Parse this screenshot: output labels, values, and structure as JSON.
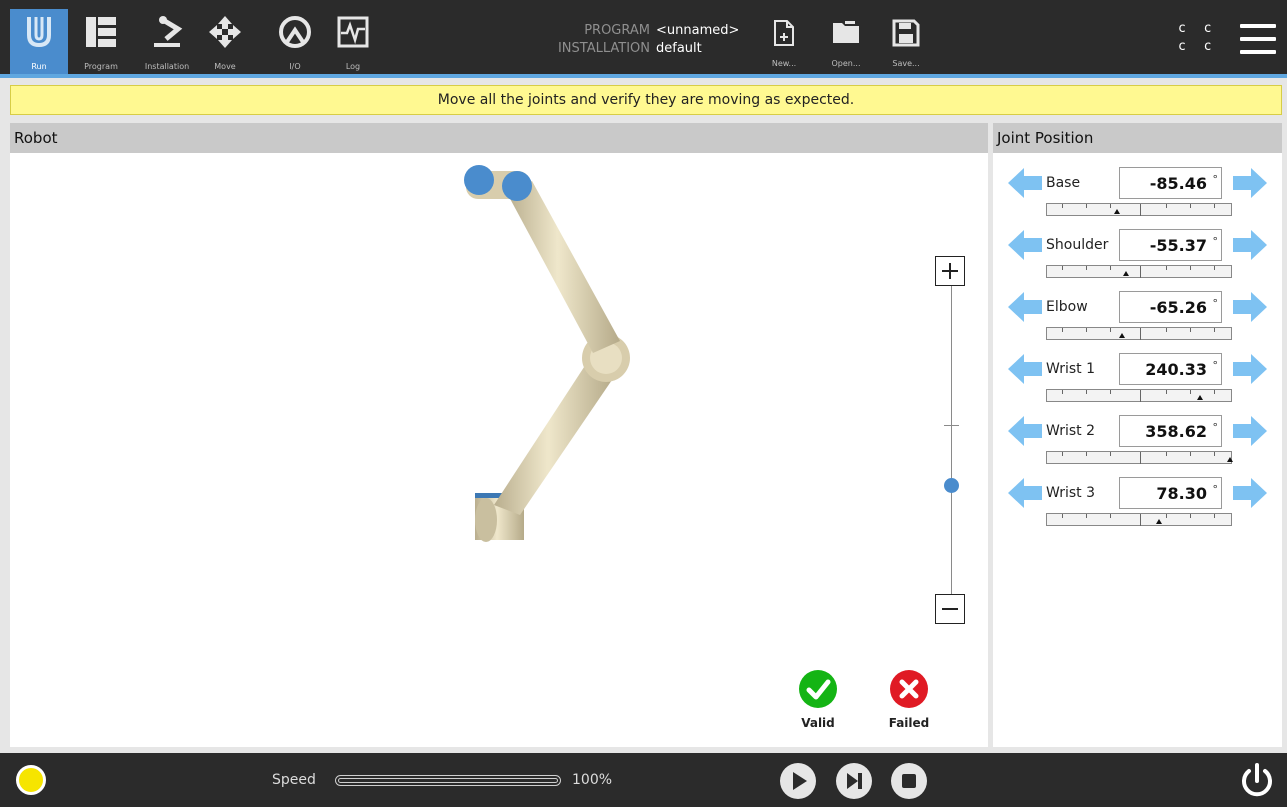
{
  "header": {
    "nav": [
      {
        "label": "Run",
        "icon": "ur-logo-icon"
      },
      {
        "label": "Program",
        "icon": "program-icon"
      },
      {
        "label": "Installation",
        "icon": "installation-icon"
      },
      {
        "label": "Move",
        "icon": "move-icon"
      },
      {
        "label": "I/O",
        "icon": "io-icon"
      },
      {
        "label": "Log",
        "icon": "log-icon"
      }
    ],
    "program_key": "PROGRAM",
    "program_value": "<unnamed>",
    "installation_key": "INSTALLATION",
    "installation_value": "default",
    "file_buttons": [
      {
        "label": "New...",
        "icon": "new-file-icon"
      },
      {
        "label": "Open...",
        "icon": "folder-icon"
      },
      {
        "label": "Save...",
        "icon": "save-icon"
      }
    ],
    "cc_icon": "c c\nc c",
    "menu_icon": "hamburger-menu-icon"
  },
  "banner": {
    "message": "Move all the joints and verify they are moving as expected."
  },
  "robot_panel": {
    "title": "Robot",
    "zoom_level": 0.3,
    "valid_label": "Valid",
    "failed_label": "Failed"
  },
  "joint_panel": {
    "title": "Joint Position",
    "joints": [
      {
        "name": "Base",
        "value": "-85.46",
        "unit": "°",
        "level": 0.38
      },
      {
        "name": "Shoulder",
        "value": "-55.37",
        "unit": "°",
        "level": 0.43
      },
      {
        "name": "Elbow",
        "value": "-65.26",
        "unit": "°",
        "level": 0.41
      },
      {
        "name": "Wrist 1",
        "value": "240.33",
        "unit": "°",
        "level": 0.83
      },
      {
        "name": "Wrist 2",
        "value": "358.62",
        "unit": "°",
        "level": 0.997
      },
      {
        "name": "Wrist 3",
        "value": "78.30",
        "unit": "°",
        "level": 0.61
      }
    ]
  },
  "footer": {
    "status_color": "#f6e500",
    "speed_label": "Speed",
    "speed_value": "100%",
    "speed_fraction": 1.0
  },
  "colors": {
    "accent": "#4a8ccd",
    "banner": "#fff991",
    "arrow": "#7ec2f2",
    "valid": "#14b414",
    "failed": "#e01a24",
    "robot_body": "#e3d9b9"
  }
}
